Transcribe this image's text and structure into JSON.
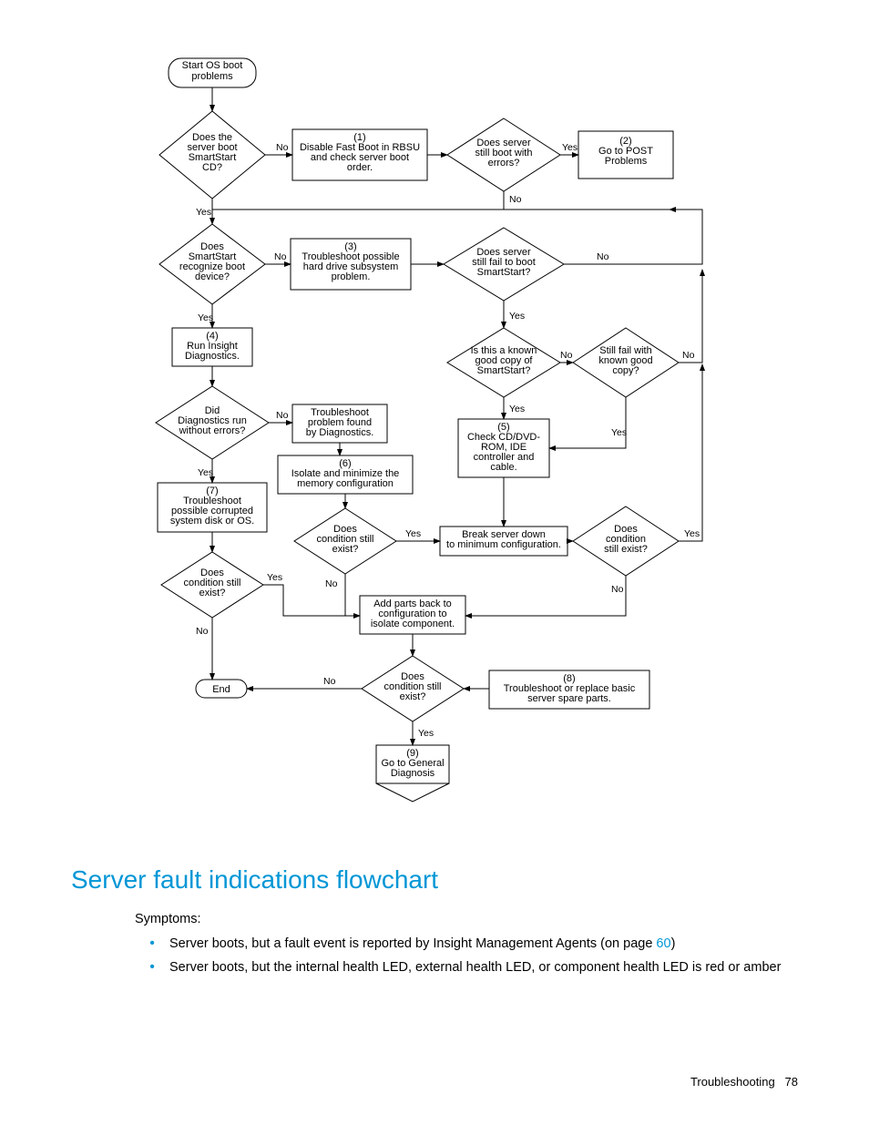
{
  "flow": {
    "start": "Start OS boot\nproblems",
    "d_boot_cd": "Does the\nserver boot\nSmartStart\nCD?",
    "p1": "(1)\nDisable Fast Boot in RBSU\nand check server boot\norder.",
    "d_still_err": "Does server\nstill boot with\nerrors?",
    "p2": "(2)\nGo to POST\nProblems",
    "d_recognize": "Does\nSmartStart\nrecognize boot\ndevice?",
    "p3": "(3)\nTroubleshoot possible\nhard drive subsystem\nproblem.",
    "d_still_fail_ss": "Does server\nstill fail to boot\nSmartStart?",
    "p4": "(4)\nRun Insight\nDiagnostics.",
    "d_known_copy": "Is this a known\ngood copy of\nSmartStart?",
    "d_still_fail_good": "Still fail with\nknown good\ncopy?",
    "d_diag_ok": "Did\nDiagnostics run\nwithout errors?",
    "p_diag_trouble": "Troubleshoot\nproblem found\nby Diagnostics.",
    "p5": "(5)\nCheck CD/DVD-\nROM, IDE\ncontroller and\ncable.",
    "p6": "(6)\nIsolate and minimize the\nmemory configuration",
    "p7": "(7)\nTroubleshoot\npossible corrupted\nsystem disk or OS.",
    "d_cond6": "Does\ncondition still\nexist?",
    "p_break": "Break server down\nto minimum configuration.",
    "d_cond_right": "Does\ncondition\nstill exist?",
    "d_cond7": "Does\ncondition still\nexist?",
    "p_addback": "Add parts back to\nconfiguration to\nisolate component.",
    "d_cond_end": "Does\ncondition still\nexist?",
    "p8": "(8)\nTroubleshoot or replace basic\nserver spare parts.",
    "end": "End",
    "p9": "(9)\nGo to General\nDiagnosis",
    "yes": "Yes",
    "no": "No"
  },
  "heading": "Server fault indications flowchart",
  "symptoms_label": "Symptoms:",
  "bullet1_a": "Server boots, but a fault event is reported by Insight Management Agents (on page ",
  "bullet1_link": "60",
  "bullet1_b": ")",
  "bullet2": "Server boots, but the internal health LED, external health LED, or component health LED is red or amber",
  "footer_label": "Troubleshooting",
  "footer_page": "78"
}
